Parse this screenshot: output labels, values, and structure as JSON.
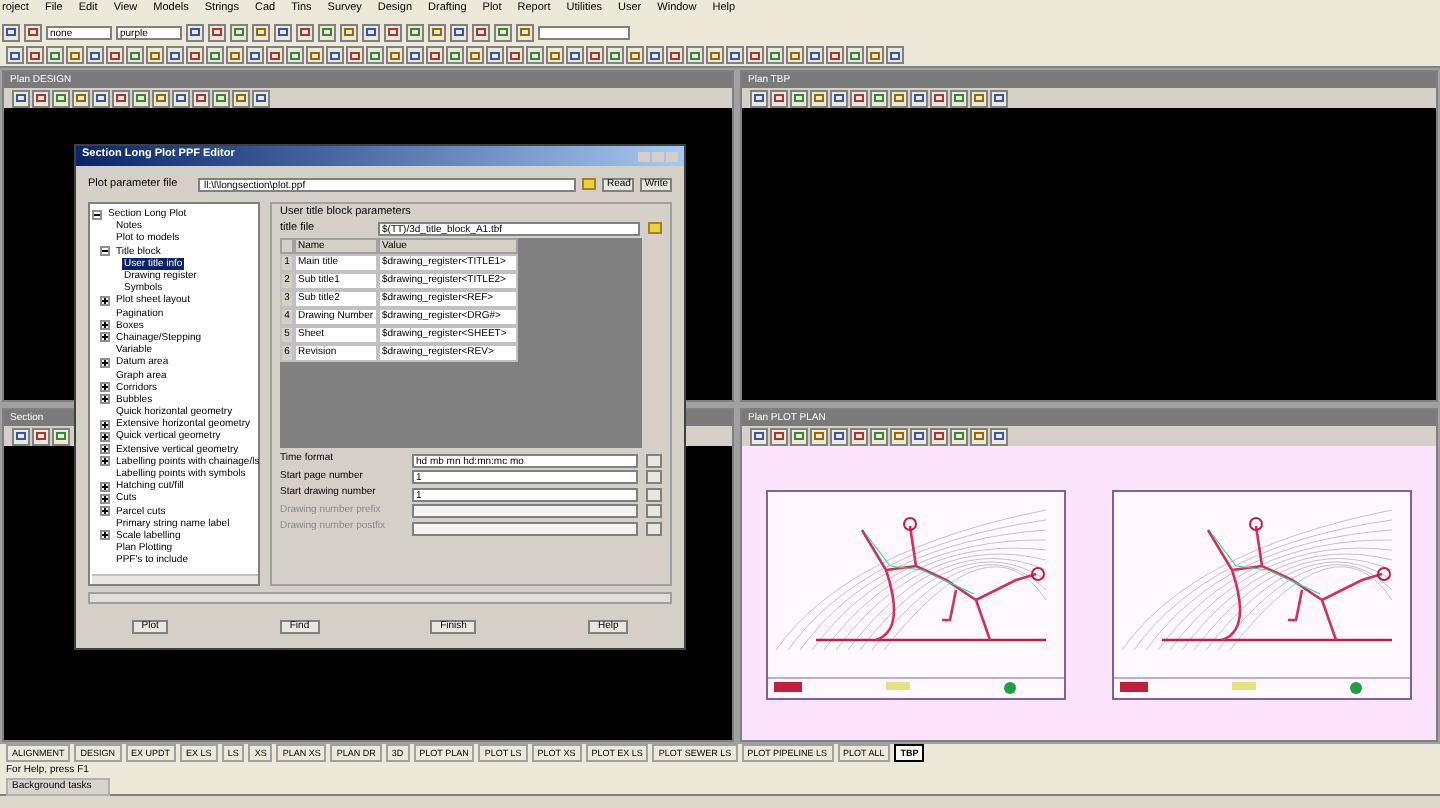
{
  "menu": [
    "roject",
    "File",
    "Edit",
    "View",
    "Models",
    "Strings",
    "Cad",
    "Tins",
    "Survey",
    "Design",
    "Drafting",
    "Plot",
    "Report",
    "Utilities",
    "User",
    "Window",
    "Help"
  ],
  "toolbar": {
    "fields": [
      "none",
      "purple"
    ]
  },
  "windows": [
    {
      "title": "Plan DESIGN",
      "kind": "black"
    },
    {
      "title": "Plan TBP",
      "kind": "black"
    },
    {
      "title": "Section",
      "kind": "black"
    },
    {
      "title": "Plan PLOT PLAN",
      "kind": "plot"
    }
  ],
  "dialog": {
    "title": "Section Long Plot PPF Editor",
    "param_label": "Plot parameter file",
    "param_value": "ll:\\l\\longsection\\plot.ppf",
    "read": "Read",
    "write": "Write",
    "tree": [
      {
        "label": "Section Long Plot",
        "expanded": true,
        "selected": false,
        "children": [
          {
            "label": "Notes",
            "selected": false
          },
          {
            "label": "Plot to models",
            "selected": false
          },
          {
            "label": "Title block",
            "expanded": true,
            "selected": false,
            "children": [
              {
                "label": "User title info",
                "selected": true
              },
              {
                "label": "Drawing register",
                "selected": false
              },
              {
                "label": "Symbols",
                "selected": false
              }
            ]
          },
          {
            "label": "Plot sheet layout",
            "expanded": false,
            "selected": false
          },
          {
            "label": "Pagination",
            "selected": false
          },
          {
            "label": "Boxes",
            "expanded": false,
            "selected": false
          },
          {
            "label": "Chainage/Stepping",
            "expanded": false,
            "selected": false
          },
          {
            "label": "Variable",
            "selected": false
          },
          {
            "label": "Datum area",
            "expanded": false,
            "selected": false
          },
          {
            "label": "Graph area",
            "selected": false
          },
          {
            "label": "Corridors",
            "expanded": false,
            "selected": false
          },
          {
            "label": "Bubbles",
            "expanded": false,
            "selected": false
          },
          {
            "label": "Quick horizontal geometry",
            "selected": false
          },
          {
            "label": "Extensive horizontal geometry",
            "expanded": false,
            "selected": false
          },
          {
            "label": "Quick vertical geometry",
            "expanded": false,
            "selected": false
          },
          {
            "label": "Extensive vertical geometry",
            "expanded": false,
            "selected": false
          },
          {
            "label": "Labelling points with chainage/ls",
            "expanded": false,
            "selected": false
          },
          {
            "label": "Labelling points with symbols",
            "selected": false
          },
          {
            "label": "Hatching cut/fill",
            "expanded": false,
            "selected": false
          },
          {
            "label": "Cuts",
            "expanded": false,
            "selected": false
          },
          {
            "label": "Parcel cuts",
            "expanded": false,
            "selected": false
          },
          {
            "label": "Primary string name label",
            "selected": false
          },
          {
            "label": "Scale labelling",
            "expanded": false,
            "selected": false
          },
          {
            "label": "Plan Plotting",
            "selected": false
          },
          {
            "label": "PPF's to include",
            "selected": false
          }
        ]
      }
    ],
    "group_title": "User title block parameters",
    "title_file_label": "title file",
    "title_file_value": "$(TT)/3d_title_block_A1.tbf",
    "table": {
      "columns": [
        "",
        "Name",
        "Value"
      ],
      "rows": [
        [
          "1",
          "Main title",
          "$drawing_register<TITLE1>"
        ],
        [
          "2",
          "Sub title1",
          "$drawing_register<TITLE2>"
        ],
        [
          "3",
          "Sub title2",
          "$drawing_register<REF>"
        ],
        [
          "4",
          "Drawing Number",
          "$drawing_register<DRG#>"
        ],
        [
          "5",
          "Sheet",
          "$drawing_register<SHEET>"
        ],
        [
          "6",
          "Revision",
          "$drawing_register<REV>"
        ]
      ]
    },
    "fields": [
      {
        "label": "Time format",
        "value": "hd mb mn hd:mn:mc mo",
        "disabled": false
      },
      {
        "label": "Start page number",
        "value": "1",
        "disabled": false
      },
      {
        "label": "Start drawing number",
        "value": "1",
        "disabled": false
      },
      {
        "label": "Drawing number prefix",
        "disabled": true
      },
      {
        "label": "Drawing number postfix",
        "disabled": true
      }
    ],
    "buttons": [
      "Plot",
      "Find",
      "Finish",
      "Help"
    ]
  },
  "tabs": [
    {
      "label": "ALIGNMENT",
      "selected": false
    },
    {
      "label": "DESIGN",
      "selected": false
    },
    {
      "label": "EX UPDT",
      "selected": false
    },
    {
      "label": "EX LS",
      "selected": false
    },
    {
      "label": "LS",
      "selected": false
    },
    {
      "label": "XS",
      "selected": false
    },
    {
      "label": "PLAN XS",
      "selected": false
    },
    {
      "label": "PLAN DR",
      "selected": false
    },
    {
      "label": "3D",
      "selected": false
    },
    {
      "label": "PLOT PLAN",
      "selected": false
    },
    {
      "label": "PLOT LS",
      "selected": false
    },
    {
      "label": "PLOT XS",
      "selected": false
    },
    {
      "label": "PLOT EX LS",
      "selected": false
    },
    {
      "label": "PLOT SEWER LS",
      "selected": false
    },
    {
      "label": "PLOT PIPELINE LS",
      "selected": false
    },
    {
      "label": "PLOT ALL",
      "selected": false
    },
    {
      "label": "TBP",
      "selected": true
    }
  ],
  "status_bar": "For Help, press F1",
  "background_tasks": "Background tasks"
}
